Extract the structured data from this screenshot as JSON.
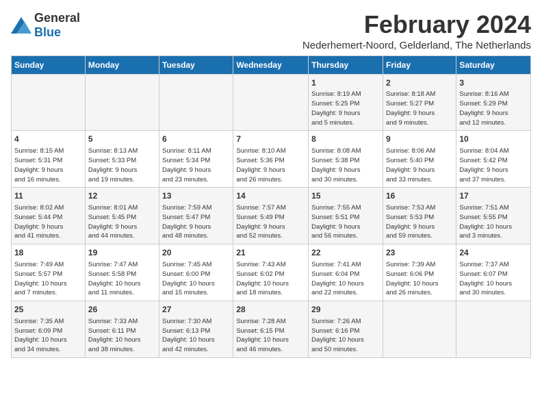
{
  "logo": {
    "general": "General",
    "blue": "Blue"
  },
  "title": "February 2024",
  "subtitle": "Nederhemert-Noord, Gelderland, The Netherlands",
  "days_of_week": [
    "Sunday",
    "Monday",
    "Tuesday",
    "Wednesday",
    "Thursday",
    "Friday",
    "Saturday"
  ],
  "weeks": [
    [
      {
        "day": "",
        "info": ""
      },
      {
        "day": "",
        "info": ""
      },
      {
        "day": "",
        "info": ""
      },
      {
        "day": "",
        "info": ""
      },
      {
        "day": "1",
        "info": "Sunrise: 8:19 AM\nSunset: 5:25 PM\nDaylight: 9 hours\nand 5 minutes."
      },
      {
        "day": "2",
        "info": "Sunrise: 8:18 AM\nSunset: 5:27 PM\nDaylight: 9 hours\nand 9 minutes."
      },
      {
        "day": "3",
        "info": "Sunrise: 8:16 AM\nSunset: 5:29 PM\nDaylight: 9 hours\nand 12 minutes."
      }
    ],
    [
      {
        "day": "4",
        "info": "Sunrise: 8:15 AM\nSunset: 5:31 PM\nDaylight: 9 hours\nand 16 minutes."
      },
      {
        "day": "5",
        "info": "Sunrise: 8:13 AM\nSunset: 5:33 PM\nDaylight: 9 hours\nand 19 minutes."
      },
      {
        "day": "6",
        "info": "Sunrise: 8:11 AM\nSunset: 5:34 PM\nDaylight: 9 hours\nand 23 minutes."
      },
      {
        "day": "7",
        "info": "Sunrise: 8:10 AM\nSunset: 5:36 PM\nDaylight: 9 hours\nand 26 minutes."
      },
      {
        "day": "8",
        "info": "Sunrise: 8:08 AM\nSunset: 5:38 PM\nDaylight: 9 hours\nand 30 minutes."
      },
      {
        "day": "9",
        "info": "Sunrise: 8:06 AM\nSunset: 5:40 PM\nDaylight: 9 hours\nand 33 minutes."
      },
      {
        "day": "10",
        "info": "Sunrise: 8:04 AM\nSunset: 5:42 PM\nDaylight: 9 hours\nand 37 minutes."
      }
    ],
    [
      {
        "day": "11",
        "info": "Sunrise: 8:02 AM\nSunset: 5:44 PM\nDaylight: 9 hours\nand 41 minutes."
      },
      {
        "day": "12",
        "info": "Sunrise: 8:01 AM\nSunset: 5:45 PM\nDaylight: 9 hours\nand 44 minutes."
      },
      {
        "day": "13",
        "info": "Sunrise: 7:59 AM\nSunset: 5:47 PM\nDaylight: 9 hours\nand 48 minutes."
      },
      {
        "day": "14",
        "info": "Sunrise: 7:57 AM\nSunset: 5:49 PM\nDaylight: 9 hours\nand 52 minutes."
      },
      {
        "day": "15",
        "info": "Sunrise: 7:55 AM\nSunset: 5:51 PM\nDaylight: 9 hours\nand 56 minutes."
      },
      {
        "day": "16",
        "info": "Sunrise: 7:53 AM\nSunset: 5:53 PM\nDaylight: 9 hours\nand 59 minutes."
      },
      {
        "day": "17",
        "info": "Sunrise: 7:51 AM\nSunset: 5:55 PM\nDaylight: 10 hours\nand 3 minutes."
      }
    ],
    [
      {
        "day": "18",
        "info": "Sunrise: 7:49 AM\nSunset: 5:57 PM\nDaylight: 10 hours\nand 7 minutes."
      },
      {
        "day": "19",
        "info": "Sunrise: 7:47 AM\nSunset: 5:58 PM\nDaylight: 10 hours\nand 11 minutes."
      },
      {
        "day": "20",
        "info": "Sunrise: 7:45 AM\nSunset: 6:00 PM\nDaylight: 10 hours\nand 15 minutes."
      },
      {
        "day": "21",
        "info": "Sunrise: 7:43 AM\nSunset: 6:02 PM\nDaylight: 10 hours\nand 18 minutes."
      },
      {
        "day": "22",
        "info": "Sunrise: 7:41 AM\nSunset: 6:04 PM\nDaylight: 10 hours\nand 22 minutes."
      },
      {
        "day": "23",
        "info": "Sunrise: 7:39 AM\nSunset: 6:06 PM\nDaylight: 10 hours\nand 26 minutes."
      },
      {
        "day": "24",
        "info": "Sunrise: 7:37 AM\nSunset: 6:07 PM\nDaylight: 10 hours\nand 30 minutes."
      }
    ],
    [
      {
        "day": "25",
        "info": "Sunrise: 7:35 AM\nSunset: 6:09 PM\nDaylight: 10 hours\nand 34 minutes."
      },
      {
        "day": "26",
        "info": "Sunrise: 7:33 AM\nSunset: 6:11 PM\nDaylight: 10 hours\nand 38 minutes."
      },
      {
        "day": "27",
        "info": "Sunrise: 7:30 AM\nSunset: 6:13 PM\nDaylight: 10 hours\nand 42 minutes."
      },
      {
        "day": "28",
        "info": "Sunrise: 7:28 AM\nSunset: 6:15 PM\nDaylight: 10 hours\nand 46 minutes."
      },
      {
        "day": "29",
        "info": "Sunrise: 7:26 AM\nSunset: 6:16 PM\nDaylight: 10 hours\nand 50 minutes."
      },
      {
        "day": "",
        "info": ""
      },
      {
        "day": "",
        "info": ""
      }
    ]
  ]
}
